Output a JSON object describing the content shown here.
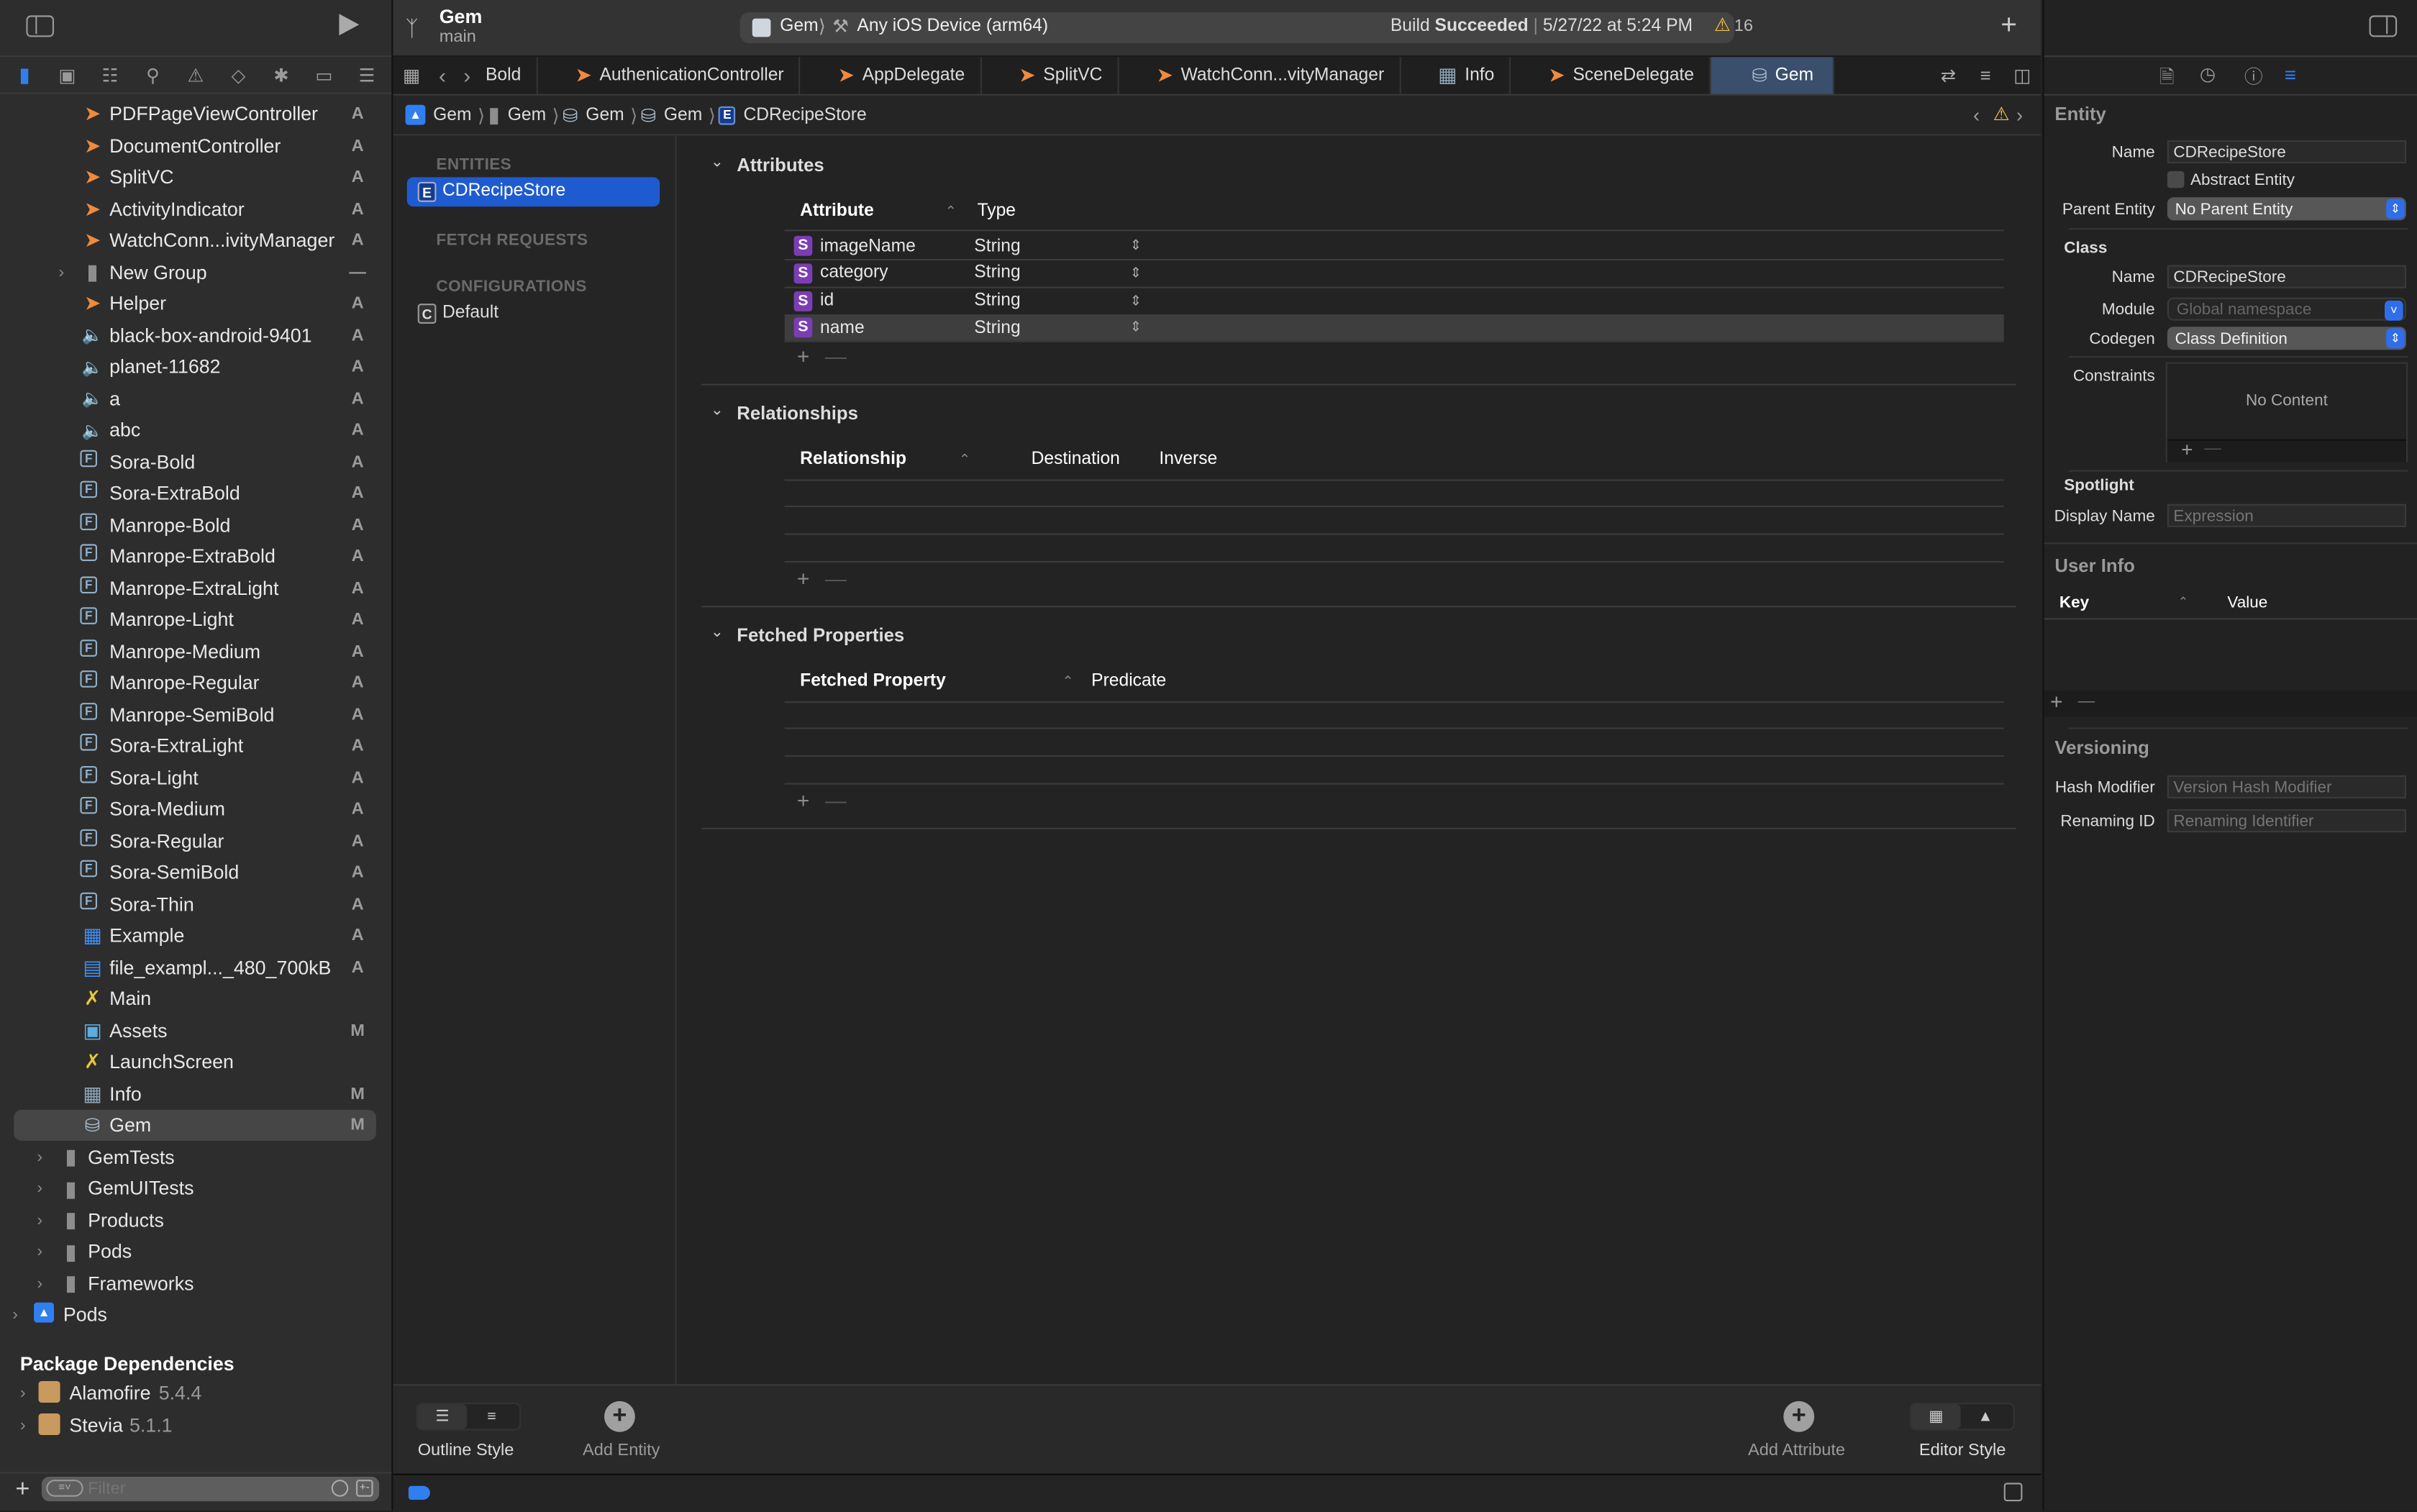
{
  "window": {
    "project_name": "Gem",
    "branch": "main",
    "scheme": "Gem",
    "destination": "Any iOS Device (arm64)",
    "build_status_prefix": "Build",
    "build_status": "Succeeded",
    "build_time": "5/27/22 at 5:24 PM",
    "warning_count": "16"
  },
  "navigator": {
    "items": [
      {
        "label": "PDFPageViewController",
        "status": "A",
        "icon": "swift-icon",
        "indent": 2
      },
      {
        "label": "DocumentController",
        "status": "A",
        "icon": "swift-icon",
        "indent": 2
      },
      {
        "label": "SplitVC",
        "status": "A",
        "icon": "swift-icon",
        "indent": 2
      },
      {
        "label": "ActivityIndicator",
        "status": "A",
        "icon": "swift-icon",
        "indent": 2
      },
      {
        "label": "WatchConn...ivityManager",
        "status": "A",
        "icon": "swift-icon",
        "indent": 2
      },
      {
        "label": "New Group",
        "status": "—",
        "icon": "folder-icon",
        "indent": 2,
        "expandable": true
      },
      {
        "label": "Helper",
        "status": "A",
        "icon": "swift-icon",
        "indent": 2
      },
      {
        "label": "black-box-android-9401",
        "status": "A",
        "icon": "audio-icon",
        "indent": 2
      },
      {
        "label": "planet-11682",
        "status": "A",
        "icon": "audio-icon",
        "indent": 2
      },
      {
        "label": "a",
        "status": "A",
        "icon": "audio-icon",
        "indent": 2
      },
      {
        "label": "abc",
        "status": "A",
        "icon": "audio-icon",
        "indent": 2
      },
      {
        "label": "Sora-Bold",
        "status": "A",
        "icon": "font-icon",
        "indent": 2
      },
      {
        "label": "Sora-ExtraBold",
        "status": "A",
        "icon": "font-icon",
        "indent": 2
      },
      {
        "label": "Manrope-Bold",
        "status": "A",
        "icon": "font-icon",
        "indent": 2
      },
      {
        "label": "Manrope-ExtraBold",
        "status": "A",
        "icon": "font-icon",
        "indent": 2
      },
      {
        "label": "Manrope-ExtraLight",
        "status": "A",
        "icon": "font-icon",
        "indent": 2
      },
      {
        "label": "Manrope-Light",
        "status": "A",
        "icon": "font-icon",
        "indent": 2
      },
      {
        "label": "Manrope-Medium",
        "status": "A",
        "icon": "font-icon",
        "indent": 2
      },
      {
        "label": "Manrope-Regular",
        "status": "A",
        "icon": "font-icon",
        "indent": 2
      },
      {
        "label": "Manrope-SemiBold",
        "status": "A",
        "icon": "font-icon",
        "indent": 2
      },
      {
        "label": "Sora-ExtraLight",
        "status": "A",
        "icon": "font-icon",
        "indent": 2
      },
      {
        "label": "Sora-Light",
        "status": "A",
        "icon": "font-icon",
        "indent": 2
      },
      {
        "label": "Sora-Medium",
        "status": "A",
        "icon": "font-icon",
        "indent": 2
      },
      {
        "label": "Sora-Regular",
        "status": "A",
        "icon": "font-icon",
        "indent": 2
      },
      {
        "label": "Sora-SemiBold",
        "status": "A",
        "icon": "font-icon",
        "indent": 2
      },
      {
        "label": "Sora-Thin",
        "status": "A",
        "icon": "font-icon",
        "indent": 2
      },
      {
        "label": "Example",
        "status": "A",
        "icon": "image-icon",
        "indent": 2
      },
      {
        "label": "file_exampl..._480_700kB",
        "status": "A",
        "icon": "video-icon",
        "indent": 2
      },
      {
        "label": "Main",
        "status": "",
        "icon": "storyboard-icon",
        "indent": 2
      },
      {
        "label": "Assets",
        "status": "M",
        "icon": "assets-icon",
        "indent": 2
      },
      {
        "label": "LaunchScreen",
        "status": "",
        "icon": "storyboard-icon",
        "indent": 2
      },
      {
        "label": "Info",
        "status": "M",
        "icon": "plist-icon",
        "indent": 2
      },
      {
        "label": "Gem",
        "status": "M",
        "icon": "datamodel-icon",
        "indent": 2,
        "selected": true
      },
      {
        "label": "GemTests",
        "status": "",
        "icon": "folder-icon",
        "indent": 1,
        "expandable": true
      },
      {
        "label": "GemUITests",
        "status": "",
        "icon": "folder-icon",
        "indent": 1,
        "expandable": true
      },
      {
        "label": "Products",
        "status": "",
        "icon": "folder-icon",
        "indent": 1,
        "expandable": true
      },
      {
        "label": "Pods",
        "status": "",
        "icon": "folder-icon",
        "indent": 1,
        "expandable": true
      },
      {
        "label": "Frameworks",
        "status": "",
        "icon": "folder-icon",
        "indent": 1,
        "expandable": true
      },
      {
        "label": "Pods",
        "status": "",
        "icon": "project-icon",
        "indent": 0,
        "expandable": true
      }
    ],
    "package_header": "Package Dependencies",
    "packages": [
      {
        "name": "Alamofire",
        "version": "5.4.4"
      },
      {
        "name": "Stevia",
        "version": "5.1.1"
      }
    ],
    "filter_placeholder": "Filter"
  },
  "tabs": [
    {
      "label": "Bold",
      "icon": ""
    },
    {
      "label": "AuthenicationController",
      "icon": "swift-icon"
    },
    {
      "label": "AppDelegate",
      "icon": "swift-icon"
    },
    {
      "label": "SplitVC",
      "icon": "swift-icon"
    },
    {
      "label": "WatchConn...vityManager",
      "icon": "swift-icon"
    },
    {
      "label": "Info",
      "icon": "plist-icon"
    },
    {
      "label": "SceneDelegate",
      "icon": "swift-icon"
    },
    {
      "label": "Gem",
      "icon": "datamodel-icon",
      "active": true
    }
  ],
  "breadcrumb": [
    "Gem",
    "Gem",
    "Gem",
    "Gem",
    "CDRecipeStore"
  ],
  "entities_pane": {
    "entities_header": "ENTITIES",
    "entities": [
      "CDRecipeStore"
    ],
    "fetch_header": "FETCH REQUESTS",
    "config_header": "CONFIGURATIONS",
    "configurations": [
      "Default"
    ]
  },
  "editor": {
    "attributes": {
      "title": "Attributes",
      "col_attribute": "Attribute",
      "col_type": "Type",
      "rows": [
        {
          "name": "imageName",
          "type": "String"
        },
        {
          "name": "category",
          "type": "String"
        },
        {
          "name": "id",
          "type": "String"
        },
        {
          "name": "name",
          "type": "String",
          "selected": true
        }
      ]
    },
    "relationships": {
      "title": "Relationships",
      "col_relationship": "Relationship",
      "col_destination": "Destination",
      "col_inverse": "Inverse"
    },
    "fetched": {
      "title": "Fetched Properties",
      "col_property": "Fetched Property",
      "col_predicate": "Predicate"
    }
  },
  "bottom_bar": {
    "outline_style": "Outline Style",
    "add_entity": "Add Entity",
    "add_attribute": "Add Attribute",
    "editor_style": "Editor Style"
  },
  "inspector": {
    "entity_title": "Entity",
    "name_label": "Name",
    "name_value": "CDRecipeStore",
    "abstract_label": "Abstract Entity",
    "abstract_checked": false,
    "parent_label": "Parent Entity",
    "parent_value": "No Parent Entity",
    "class_title": "Class",
    "class_name_label": "Name",
    "class_name_value": "CDRecipeStore",
    "module_label": "Module",
    "module_placeholder": "Global namespace",
    "codegen_label": "Codegen",
    "codegen_value": "Class Definition",
    "constraints_label": "Constraints",
    "constraints_empty": "No Content",
    "spotlight_title": "Spotlight",
    "display_name_label": "Display Name",
    "display_name_placeholder": "Expression",
    "user_info_title": "User Info",
    "key_header": "Key",
    "value_header": "Value",
    "versioning_title": "Versioning",
    "hash_label": "Hash Modifier",
    "hash_placeholder": "Version Hash Modifier",
    "renaming_label": "Renaming ID",
    "renaming_placeholder": "Renaming Identifier"
  },
  "colors": {
    "accent": "#2f6ee8",
    "selection": "#1f5bd0",
    "swift": "#f08a3c",
    "warning": "#f5c242",
    "string_badge": "#7b3db3"
  }
}
